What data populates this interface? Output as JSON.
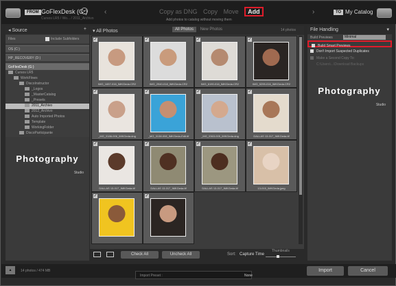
{
  "top": {
    "from_label": "FROM",
    "source_drive": "GoFlexDesk (G:)",
    "source_path": "Cursos LR5 / Wo... / 2011_Archivo",
    "modes": [
      "Copy as DNG",
      "Copy",
      "Move",
      "Add"
    ],
    "mode_active": "Add",
    "mode_subtitle": "Add photos to catalog without moving them",
    "to_label": "TO",
    "dest": "My Catalog"
  },
  "source": {
    "title": "Source",
    "files_label": "Files",
    "include_subfolders": "Include Subfolders",
    "drives": [
      "OS (C:)",
      "HP_RECOVERY (D:)",
      "GoFlexDesk (G:)"
    ],
    "tree": [
      {
        "label": "Cursos LR5",
        "indent": 0,
        "selected": false
      },
      {
        "label": "WorkFlows",
        "indent": 1,
        "selected": false
      },
      {
        "label": "DiscoInstructor",
        "indent": 2,
        "selected": false
      },
      {
        "label": "_Logos",
        "indent": 3,
        "selected": false
      },
      {
        "label": "_MasterCatalog",
        "indent": 3,
        "selected": false
      },
      {
        "label": "_Presets",
        "indent": 3,
        "selected": false
      },
      {
        "label": "2011_Archivo",
        "indent": 3,
        "selected": true
      },
      {
        "label": "2012_Archivo",
        "indent": 3,
        "selected": false
      },
      {
        "label": "Auto Imported Photos",
        "indent": 3,
        "selected": false
      },
      {
        "label": "Template",
        "indent": 3,
        "selected": false
      },
      {
        "label": "WorkingFolder",
        "indent": 3,
        "selected": false
      },
      {
        "label": "DiscoParticipante",
        "indent": 2,
        "selected": false
      }
    ],
    "logo": "Photography",
    "logo_sub": "Studio"
  },
  "center": {
    "title": "All Photos",
    "tabs": [
      "All Photos",
      "New Photos"
    ],
    "active_tab": "All Photos",
    "count": "14 photos",
    "photos": [
      {
        "name": "IMG_1657-016_IMKGeda.CR2",
        "color": "#e8e3dc",
        "skin": "#c79a80"
      },
      {
        "name": "IMG_2940-018_IMKGeda.CR2",
        "color": "#dcdcdc",
        "skin": "#c99b7c"
      },
      {
        "name": "IMG_6190-016_IMKGeda.CR2",
        "color": "#dedbd6",
        "skin": "#b58a70"
      },
      {
        "name": "IMG_5295-016_IMKGeda.CR2",
        "color": "#2a2523",
        "skin": "#a06a50"
      },
      {
        "name": "_MG_0186-006_IMKGeda.dng",
        "color": "#eae5e0",
        "skin": "#c9a08a"
      },
      {
        "name": "_MG_0138-008_IMKGeda-Edit.tif",
        "color": "#3aa3d8",
        "skin": "#c58f72"
      },
      {
        "name": "_MG_0363-005_IMKGeda.dng",
        "color": "#b9c1ce",
        "skin": "#d4a98e"
      },
      {
        "name": "DALLAS 13-017_IMKGeda.tif",
        "color": "#e4dbcd",
        "skin": "#a87758"
      },
      {
        "name": "DALLAS 13-017_IMKGeda.tif",
        "color": "#eae6e2",
        "skin": "#5b3a2a"
      },
      {
        "name": "DALLAS 13-017_IMKGeda.tif",
        "color": "#8f8a73",
        "skin": "#4f3022"
      },
      {
        "name": "DALLAS 13-017_IMKGeda.tif",
        "color": "#9c9780",
        "skin": "#4d2e20"
      },
      {
        "name": "13-015_IMKGeda.jpeg",
        "color": "#d8c0a8",
        "skin": "#e8d4c4"
      },
      {
        "name": "",
        "color": "#f0c420",
        "skin": "#8a5a3a"
      },
      {
        "name": "",
        "color": "#2b2522",
        "skin": "#c89a80"
      }
    ],
    "check_all": "Check All",
    "uncheck_all": "Uncheck All",
    "sort_label": "Sort:",
    "sort_value": "Capture Time",
    "thumbnails_label": "Thumbnails"
  },
  "file_handling": {
    "title": "File Handling",
    "build_previews_label": "Build Previews",
    "build_previews_value": "Minimal",
    "build_smart_previews": "Build Smart Previews",
    "dont_import_suspected": "Don't Import Suspected Duplicates",
    "second_copy": "Make a Second Copy To:",
    "second_copy_path": "C:\\Users\\...\\Download Backups"
  },
  "bottom": {
    "status": "14 photos / 474 MB",
    "import_preset_label": "Import Preset :",
    "import_preset_value": "None",
    "import": "Import",
    "cancel": "Cancel"
  }
}
